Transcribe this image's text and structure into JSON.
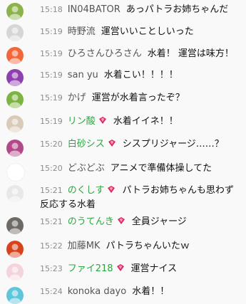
{
  "chat": {
    "messages": [
      {
        "time": "15:18",
        "author": "IN04BATOR",
        "text": "あっパトラお姉ちゃんだ",
        "member": false,
        "avatar": "#8bb34a"
      },
      {
        "time": "15:19",
        "author": "時野流",
        "text": "運営いいことしいった",
        "member": false,
        "avatar": "#d6d6d6"
      },
      {
        "time": "15:19",
        "author": "ひろさんひろさん",
        "text": "水着！ 運営は味方！",
        "member": false,
        "avatar": "#f2663a"
      },
      {
        "time": "15:19",
        "author": "san yu",
        "text": "水着こい！！！！",
        "member": false,
        "avatar": "#8e3fb0"
      },
      {
        "time": "15:19",
        "author": "かげ",
        "text": "運営が水着言ったぞ？",
        "member": false,
        "avatar": "#7cb342"
      },
      {
        "time": "15:19",
        "author": "リン酸",
        "text": "水着イイネ！！",
        "member": true,
        "avatar": "#d9cbb8"
      },
      {
        "time": "15:20",
        "author": "白砂シス",
        "text": "シスプリジャージ……？",
        "member": true,
        "avatar": "#b24a8a"
      },
      {
        "time": "15:20",
        "author": "どぶどぶ",
        "text": "アニメで準備体操してた",
        "member": false,
        "avatar": "#ffffff"
      },
      {
        "time": "15:21",
        "author": "のくしす",
        "text": "パトラお姉ちゃんも思わず反応する水着",
        "member": true,
        "avatar": "#e8e8e8"
      },
      {
        "time": "15:21",
        "author": "のうてんき",
        "text": "全員ジャージ",
        "member": true,
        "avatar": "#6e6a66"
      },
      {
        "time": "15:22",
        "author": "加藤MK",
        "text": "パトラちゃんいたｗ",
        "member": false,
        "avatar": "#d8431e"
      },
      {
        "time": "15:23",
        "author": "ファイ218",
        "text": "運営ナイス",
        "member": true,
        "avatar": "#f4d4dc"
      },
      {
        "time": "15:24",
        "author": "konoka dayo",
        "text": "水着！！",
        "member": false,
        "avatar": "#5fc6d9"
      }
    ]
  },
  "colors": {
    "background": "#f9f9f9",
    "timestamp": "#8d8d8d",
    "author": "#555555",
    "member_author": "#2ba640",
    "badge": "#e0245e"
  }
}
